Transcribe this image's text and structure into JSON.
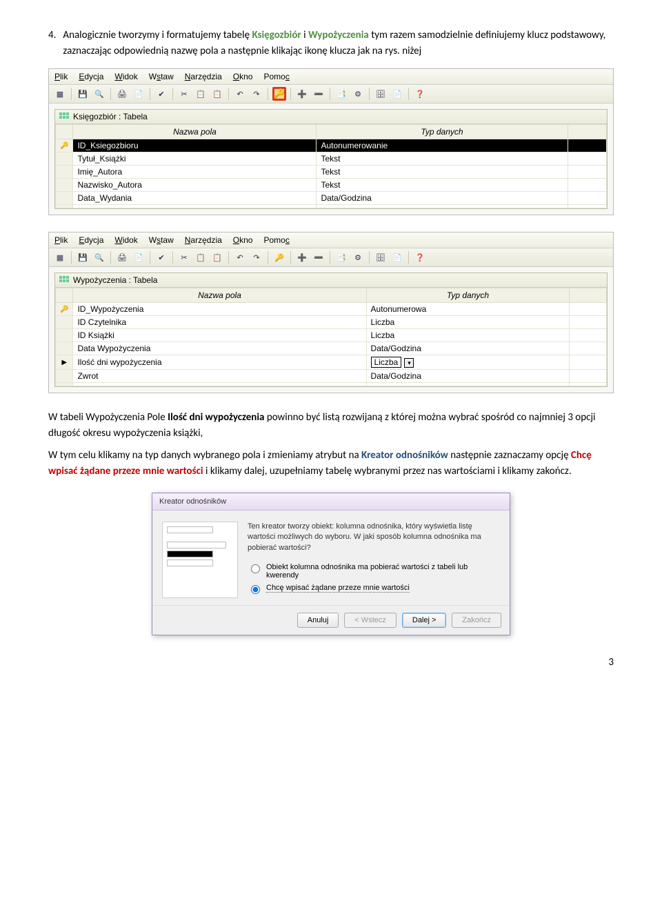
{
  "intro": {
    "number": "4.",
    "text_a": "Analogicznie tworzymy i formatujemy tabelę ",
    "table1": "Księgozbiór",
    "and": " i ",
    "table2": "Wypożyczenia",
    "text_b": " tym razem samodzielnie definiujemy klucz podstawowy, zaznaczając odpowiednią nazwę pola a następnie klikając ikonę klucza jak na rys. niżej"
  },
  "app1": {
    "menus": {
      "plik": "Plik",
      "edycja": "Edycja",
      "widok": "Widok",
      "wstaw": "Wstaw",
      "narzedzia": "Narzędzia",
      "okno": "Okno",
      "pomoc": "Pomoc"
    },
    "panel_title": "Księgozbiór : Tabela",
    "headers": {
      "name": "Nazwa pola",
      "type": "Typ danych"
    },
    "rows": [
      {
        "key": "🔑",
        "name": "ID_Ksiegozbioru",
        "type": "Autonumerowanie",
        "selected": true
      },
      {
        "key": "",
        "name": "Tytuł_Książki",
        "type": "Tekst"
      },
      {
        "key": "",
        "name": "Imię_Autora",
        "type": "Tekst"
      },
      {
        "key": "",
        "name": "Nazwisko_Autora",
        "type": "Tekst"
      },
      {
        "key": "",
        "name": "Data_Wydania",
        "type": "Data/Godzina"
      }
    ]
  },
  "app2": {
    "panel_title": "Wypożyczenia : Tabela",
    "headers": {
      "name": "Nazwa pola",
      "type": "Typ danych"
    },
    "rows": [
      {
        "key": "🔑",
        "name": "ID_Wypożyczenia",
        "type": "Autonumerowa"
      },
      {
        "key": "",
        "name": "ID Czytelnika",
        "type": "Liczba"
      },
      {
        "key": "",
        "name": "ID Książki",
        "type": "Liczba"
      },
      {
        "key": "",
        "name": "Data Wypożyczenia",
        "type": "Data/Godzina"
      },
      {
        "key": "▶",
        "name": "Ilość dni wypożyczenia",
        "type": "Liczba",
        "edit": true
      },
      {
        "key": "",
        "name": "Zwrot",
        "type": "Data/Godzina"
      }
    ]
  },
  "para1_a": "W tabeli Wypożyczenia Pole ",
  "para1_bold": "Ilość dni wypożyczenia",
  "para1_b": " powinno być listą rozwijaną z której można wybrać spośród co najmniej 3 opcji długość okresu wypożyczenia książki,",
  "para2_a": "W tym celu klikamy na typ danych wybranego pola i zmieniamy atrybut na ",
  "kreator": "Kreator odnośników",
  "para2_b": " następnie zaznaczamy opcję ",
  "chce": "Chcę wpisać żądane przeze mnie wartości",
  "para2_c": " i klikamy dalej, uzupełniamy tabelę wybranymi przez nas wartościami i klikamy zakończ.",
  "wizard": {
    "title": "Kreator odnośników",
    "desc": "Ten kreator tworzy obiekt: kolumna odnośnika, który wyświetla listę wartości możliwych do wyboru. W jaki sposób kolumna odnośnika ma pobierać wartości?",
    "opt1": "Obiekt kolumna odnośnika ma pobierać wartości z tabeli lub kwerendy",
    "opt2": "Chcę wpisać żądane przeze mnie wartości",
    "btn_cancel": "Anuluj",
    "btn_back": "< Wstecz",
    "btn_next": "Dalej >",
    "btn_finish": "Zakończ"
  },
  "page_number": "3"
}
